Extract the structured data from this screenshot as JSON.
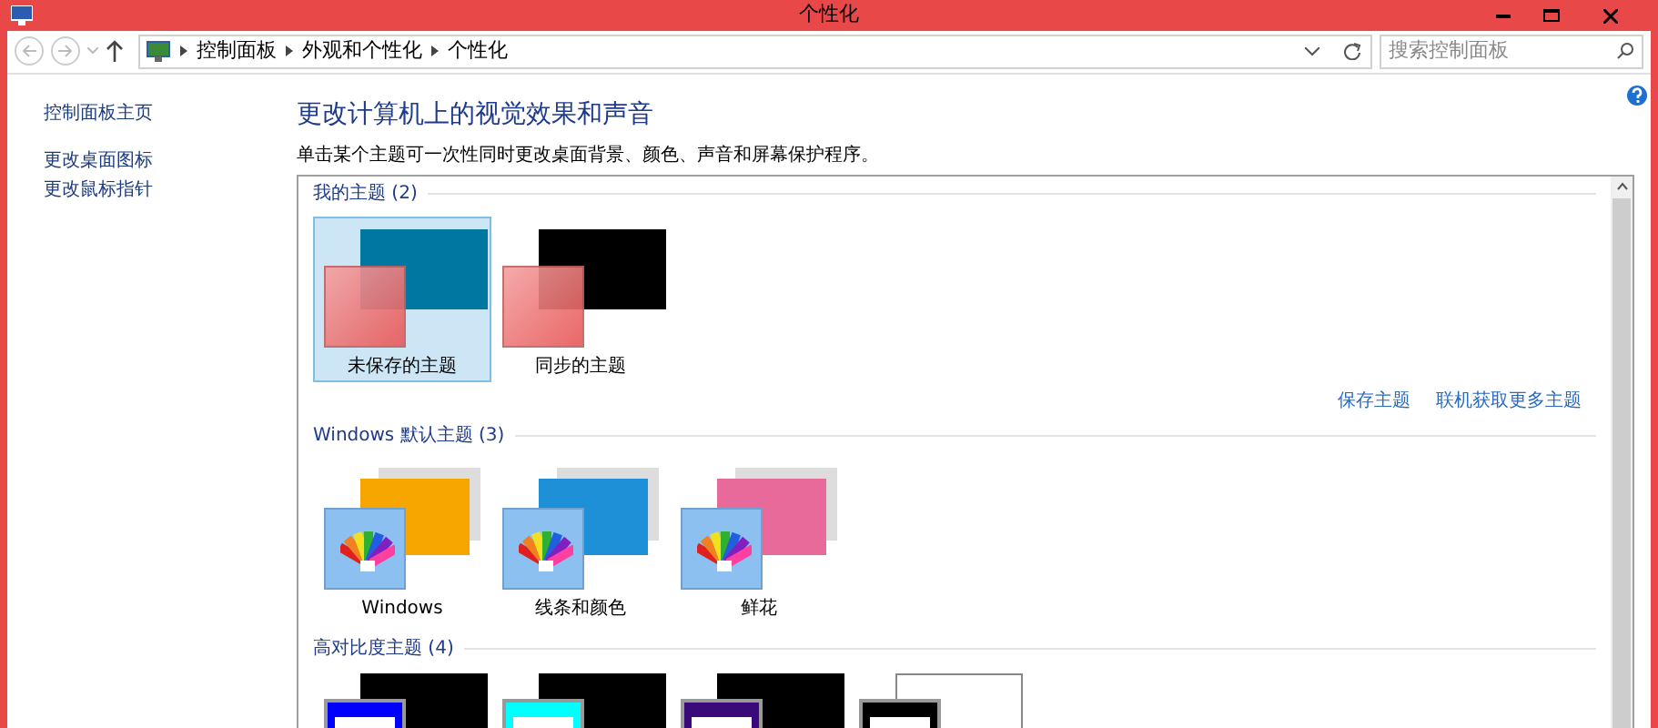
{
  "window": {
    "title": "个性化"
  },
  "address_bar": {
    "path": [
      "控制面板",
      "外观和个性化",
      "个性化"
    ],
    "search": {
      "placeholder": "搜索控制面板"
    }
  },
  "sidebar": {
    "items": [
      {
        "label": "控制面板主页"
      },
      {
        "label": "更改桌面图标"
      },
      {
        "label": "更改鼠标指针"
      }
    ]
  },
  "main": {
    "heading": "更改计算机上的视觉效果和声音",
    "description": "单击某个主题可一次性同时更改桌面背景、颜色、声音和屏幕保护程序。"
  },
  "groups": [
    {
      "title": "我的主题 (2)",
      "themes": [
        {
          "kind": "custom",
          "label": "未保存的主题",
          "color": "#0077a0",
          "selected": true
        },
        {
          "kind": "custom",
          "label": "同步的主题",
          "color": "#000000",
          "selected": false
        }
      ],
      "links": [
        "保存主题",
        "联机获取更多主题"
      ]
    },
    {
      "title": "Windows 默认主题 (3)",
      "themes": [
        {
          "kind": "picture",
          "label": "Windows",
          "color": "#f7a600",
          "selected": false
        },
        {
          "kind": "picture",
          "label": "线条和颜色",
          "color": "#1e90d8",
          "selected": false
        },
        {
          "kind": "picture",
          "label": "鲜花",
          "color": "#e86a9a",
          "selected": false
        }
      ]
    },
    {
      "title": "高对比度主题 (4)",
      "themes": [
        {
          "kind": "contrast",
          "color": "#0000ff",
          "selected": false
        },
        {
          "kind": "contrast",
          "color": "#00ffff",
          "selected": false
        },
        {
          "kind": "contrast",
          "color": "#3b0a7a",
          "selected": false
        },
        {
          "kind": "contrast_white",
          "color": "#000000",
          "selected": false
        }
      ]
    }
  ]
}
